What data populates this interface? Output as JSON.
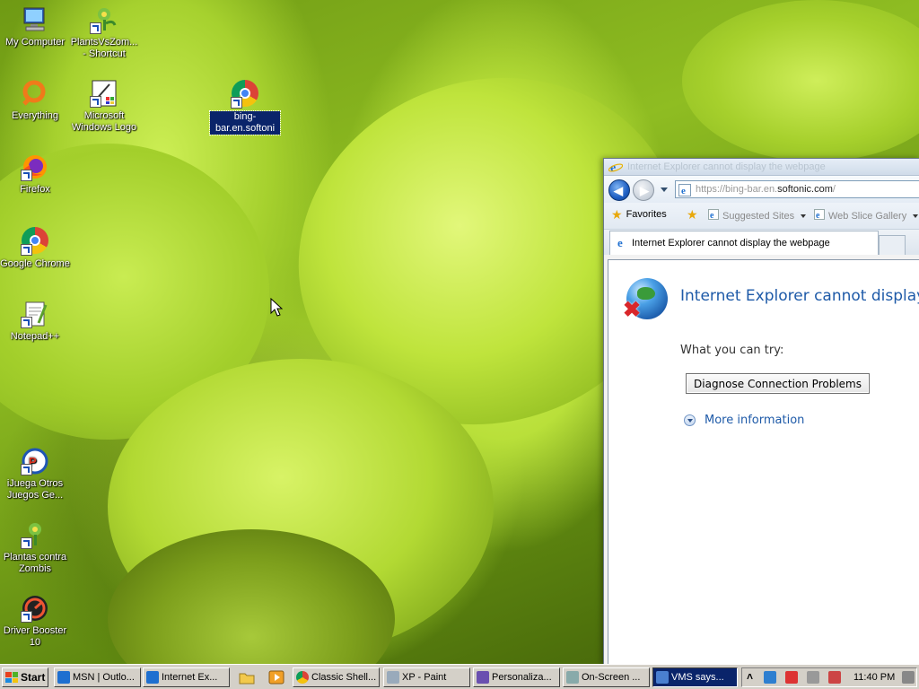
{
  "desktop": {
    "icons": {
      "my_computer": "My Computer",
      "plants_shortcut": "PlantsVsZom... - Shortcut",
      "everything": "Everything",
      "ms_windows_logo": "Microsoft Windows Logo",
      "bing_bar": "bing-bar.en.softoni",
      "firefox": "Firefox",
      "google_chrome": "Google Chrome",
      "notepadpp": "Notepad++",
      "ijuega": "iJuega Otros Juegos Ge...",
      "plantas": "Plantas contra Zombis",
      "driver_booster": "Driver Booster 10"
    }
  },
  "ie": {
    "title": "Internet Explorer cannot display the webpage",
    "address_prefix": "https://bing-bar.en.",
    "address_host": "softonic.com",
    "address_suffix": "/",
    "favorites_label": "Favorites",
    "suggested_sites": "Suggested Sites",
    "web_slice_gallery": "Web Slice Gallery",
    "tab_label": "Internet Explorer cannot display the webpage",
    "error_heading": "Internet Explorer cannot display th",
    "what_you_can_try": "What you can try:",
    "diagnose_button": "Diagnose Connection Problems",
    "more_information": "More information"
  },
  "taskbar": {
    "start_label": "Start",
    "tasks": [
      "MSN | Outlo...",
      "Internet Ex...",
      "Classic Shell...",
      "XP - Paint",
      "Personaliza...",
      "On-Screen ...",
      "VMS says..."
    ],
    "clock": "11:40 PM"
  },
  "colors": {
    "taskbar": "#d4d0c8",
    "active_task": "#0a246a",
    "link_blue": "#1e5aa8"
  }
}
